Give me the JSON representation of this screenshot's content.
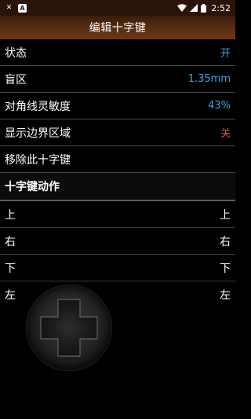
{
  "status_bar": {
    "time": "2:52",
    "left_icons": [
      "close-x-icon",
      "text-a-icon"
    ],
    "right_icons": [
      "wifi-icon",
      "signal-icon",
      "battery-icon"
    ]
  },
  "title": "编辑十字键",
  "settings": [
    {
      "label": "状态",
      "value": "开",
      "color": "#33a8e6"
    },
    {
      "label": "盲区",
      "value": "1.35mm",
      "color": "#33a8e6"
    },
    {
      "label": "对角线灵敏度",
      "value": "43%",
      "color": "#33a8e6"
    },
    {
      "label": "显示边界区域",
      "value": "关",
      "color": "#e8503a"
    },
    {
      "label": "移除此十字键",
      "value": ""
    }
  ],
  "section_title": "十字键动作",
  "actions": [
    {
      "label": "上",
      "value": "上"
    },
    {
      "label": "右",
      "value": "右"
    },
    {
      "label": "下",
      "value": "下"
    },
    {
      "label": "左",
      "value": "左"
    }
  ]
}
